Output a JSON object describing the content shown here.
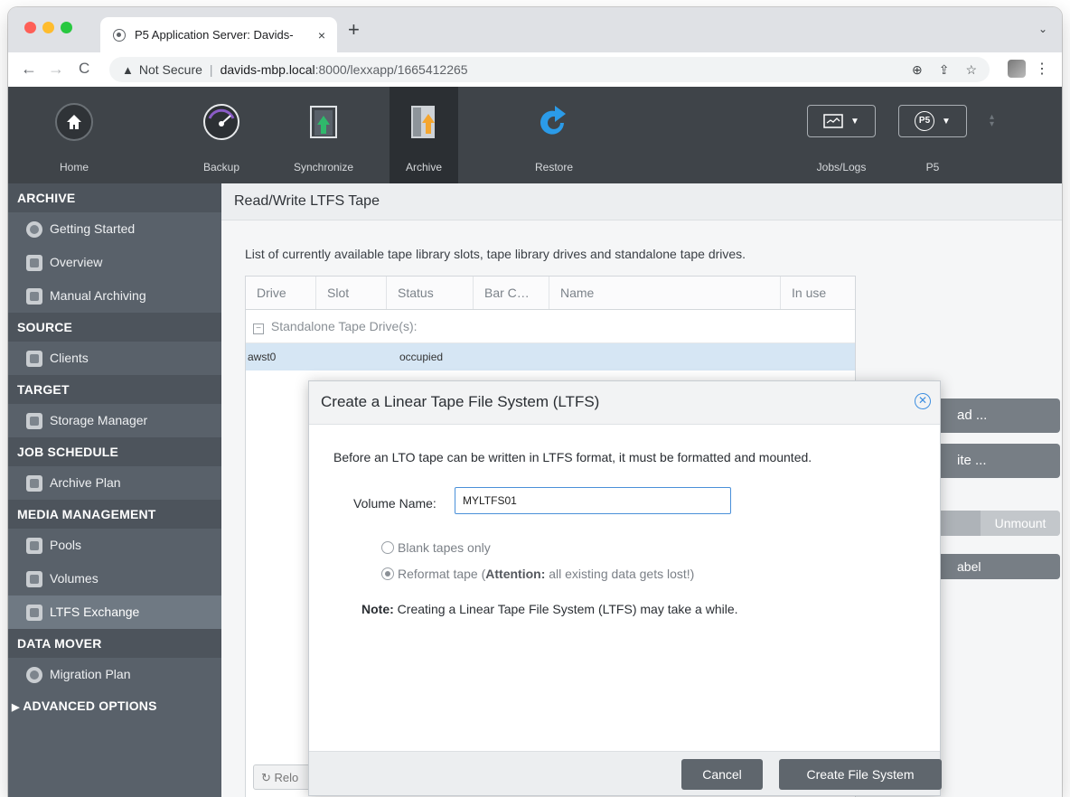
{
  "browser": {
    "tab_title": "P5 Application Server: Davids-",
    "tab_close": "×",
    "new_tab": "+",
    "tab_menu": "⌄",
    "nav_back": "←",
    "nav_forward": "→",
    "nav_reload": "C",
    "security_text": "Not Secure",
    "url_host": "davids-mbp.local",
    "url_path": ":8000/lexxapp/1665412265"
  },
  "appbar": {
    "items": [
      {
        "label": "Home"
      },
      {
        "label": "Backup"
      },
      {
        "label": "Synchronize"
      },
      {
        "label": "Archive"
      },
      {
        "label": "Restore"
      }
    ],
    "jobs_label": "Jobs/Logs",
    "p5_label": "P5",
    "p5_glyph": "P5"
  },
  "sidebar": {
    "sections": [
      {
        "title": "ARCHIVE",
        "items": [
          "Getting Started",
          "Overview",
          "Manual Archiving"
        ]
      },
      {
        "title": "SOURCE",
        "items": [
          "Clients"
        ]
      },
      {
        "title": "TARGET",
        "items": [
          "Storage Manager"
        ]
      },
      {
        "title": "JOB SCHEDULE",
        "items": [
          "Archive Plan"
        ]
      },
      {
        "title": "MEDIA MANAGEMENT",
        "items": [
          "Pools",
          "Volumes",
          "LTFS Exchange"
        ]
      },
      {
        "title": "DATA MOVER",
        "items": [
          "Migration Plan"
        ]
      }
    ],
    "advanced": "ADVANCED OPTIONS"
  },
  "main": {
    "title": "Read/Write LTFS Tape",
    "description": "List of currently available tape library slots, tape library drives and standalone tape drives.",
    "table": {
      "columns": [
        "Drive",
        "Slot",
        "Status",
        "Bar C…",
        "Name",
        "In use"
      ],
      "group": "Standalone Tape Drive(s):",
      "rows": [
        {
          "drive": "awst0",
          "slot": "",
          "status": "occupied",
          "barcode": "",
          "name": "",
          "inuse": ""
        }
      ]
    },
    "reload_label": "Relo",
    "side_buttons": {
      "read": "ad ...",
      "write": "ite ...",
      "unmount": "Unmount",
      "label": "abel"
    }
  },
  "modal": {
    "title": "Create a Linear Tape File System (LTFS)",
    "intro": "Before an LTO tape can be written in LTFS format, it must be formatted and mounted.",
    "volume_label": "Volume Name:",
    "volume_value": "MYLTFS01",
    "option_blank": "Blank tapes only",
    "option_reformat_pre": "Reformat tape (",
    "option_reformat_bold": "Attention:",
    "option_reformat_post": " all existing data gets lost!)",
    "note_bold": "Note:",
    "note_text": " Creating a Linear Tape File System (LTFS) may take a while.",
    "cancel_label": "Cancel",
    "create_label": "Create File System"
  }
}
